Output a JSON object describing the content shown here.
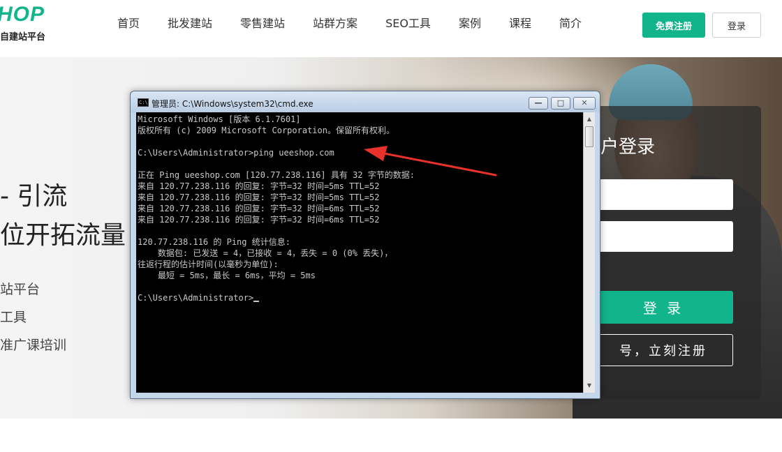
{
  "header": {
    "logo_mark": "HOP",
    "logo_subtitle": "自建站平台",
    "nav": [
      "首页",
      "批发建站",
      "零售建站",
      "站群方案",
      "SEO工具",
      "案例",
      "课程",
      "简介"
    ],
    "register_button": "免费注册",
    "login_button": "登录"
  },
  "hero": {
    "title_line1": "- 引流",
    "title_line2": "位开拓流量",
    "items": [
      "站平台",
      "工具",
      "准广课培训"
    ]
  },
  "login_card": {
    "title": "户登录",
    "username_placeholder": "",
    "password_placeholder": "",
    "login_button": "登 录",
    "signup_button": "号，立刻注册"
  },
  "cmd_window": {
    "title": "管理员: C:\\Windows\\system32\\cmd.exe",
    "icon_label": "C:\\",
    "controls": {
      "minimize": "—",
      "maximize": "□",
      "close": "✕"
    },
    "lines": [
      "Microsoft Windows [版本 6.1.7601]",
      "版权所有 (c) 2009 Microsoft Corporation。保留所有权利。",
      "",
      "C:\\Users\\Administrator>ping ueeshop.com",
      "",
      "正在 Ping ueeshop.com [120.77.238.116] 具有 32 字节的数据:",
      "来自 120.77.238.116 的回复: 字节=32 时间=5ms TTL=52",
      "来自 120.77.238.116 的回复: 字节=32 时间=5ms TTL=52",
      "来自 120.77.238.116 的回复: 字节=32 时间=6ms TTL=52",
      "来自 120.77.238.116 的回复: 字节=32 时间=6ms TTL=52",
      "",
      "120.77.238.116 的 Ping 统计信息:",
      "    数据包: 已发送 = 4，已接收 = 4，丢失 = 0 (0% 丢失)，",
      "往返行程的估计时间(以毫秒为单位):",
      "    最短 = 5ms，最长 = 6ms，平均 = 5ms",
      "",
      "C:\\Users\\Administrator>"
    ]
  },
  "colors": {
    "brand_green": "#12b48b",
    "annotation_arrow": "#e8322b",
    "console_bg": "#000000",
    "console_text": "#c8c8c8"
  },
  "icons": {
    "cmd": "cmd-window-icon",
    "annotation": "red-arrow-icon"
  }
}
